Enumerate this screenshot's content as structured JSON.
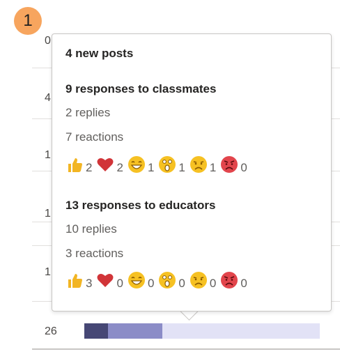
{
  "badge": {
    "number": "1"
  },
  "background": {
    "row_numbers": [
      "0",
      "4",
      "1",
      "1",
      "1"
    ],
    "visible_row": {
      "number": "26"
    },
    "progress": [
      {
        "name": "dark",
        "fraction": 0.1,
        "color": "#464775"
      },
      {
        "name": "medium",
        "fraction": 0.23,
        "color": "#8b8cc7"
      },
      {
        "name": "light",
        "fraction": 0.67,
        "color": "#e2e2f6"
      }
    ]
  },
  "card": {
    "title": "4 new posts",
    "sections": [
      {
        "heading": "9 responses to classmates",
        "replies": "2 replies",
        "reactions_line": "7 reactions",
        "reactions": [
          {
            "icon": "thumbs-up-icon",
            "count": "2"
          },
          {
            "icon": "heart-icon",
            "count": "2"
          },
          {
            "icon": "laughing-face-icon",
            "count": "1"
          },
          {
            "icon": "surprised-face-icon",
            "count": "1"
          },
          {
            "icon": "sad-face-icon",
            "count": "1"
          },
          {
            "icon": "angry-face-icon",
            "count": "0"
          }
        ]
      },
      {
        "heading": "13 responses to educators",
        "replies": "10 replies",
        "reactions_line": "3 reactions",
        "reactions": [
          {
            "icon": "thumbs-up-icon",
            "count": "3"
          },
          {
            "icon": "heart-icon",
            "count": "0"
          },
          {
            "icon": "laughing-face-icon",
            "count": "0"
          },
          {
            "icon": "surprised-face-icon",
            "count": "0"
          },
          {
            "icon": "sad-face-icon",
            "count": "0"
          },
          {
            "icon": "angry-face-icon",
            "count": "0"
          }
        ]
      }
    ]
  },
  "colors": {
    "badge": "#f7a55e",
    "thumbs": "#f2b523",
    "heart": "#d13438",
    "emoji_yellow": "#f6c123",
    "angry": "#e2454c"
  }
}
